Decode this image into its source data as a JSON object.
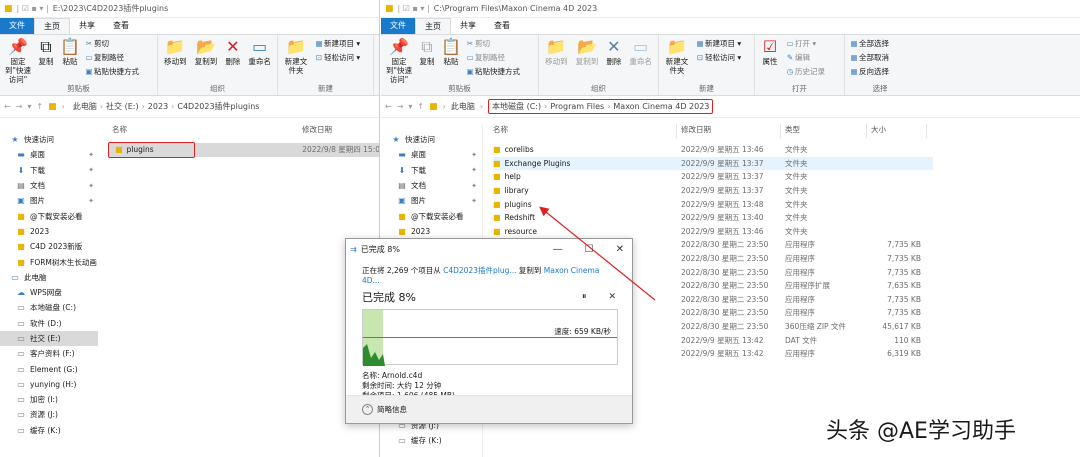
{
  "left": {
    "title_path": "E:\\2023\\C4D2023插件plugins",
    "tabs": [
      "文件",
      "主页",
      "共享",
      "查看"
    ],
    "ribbon": {
      "pin_label": "固定到\"快速访问\"",
      "copy_label": "复制",
      "paste_label": "粘贴",
      "cut_label": "剪切",
      "copy_path_label": "复制路径",
      "paste_shortcut_label": "粘贴快捷方式",
      "move_to_label": "移动到",
      "copy_to_label": "复制到",
      "delete_label": "删除",
      "rename_label": "重命名",
      "new_folder_label": "新建文件夹",
      "new_item_label": "新建项目",
      "easy_access_label": "轻松访问",
      "group_clipboard": "剪贴板",
      "group_organize": "组织",
      "group_new": "新建"
    },
    "crumbs": [
      "此电脑",
      "社交 (E:)",
      "2023",
      "C4D2023插件plugins"
    ],
    "columns": {
      "name": "名称",
      "modified": "修改日期"
    },
    "rows": [
      {
        "name": "plugins",
        "date": "2022/9/8 星期四 15:0"
      }
    ],
    "nav": [
      {
        "label": "快速访问",
        "icon": "star-icon",
        "header": true
      },
      {
        "label": "桌面",
        "icon": "desktop-icon",
        "pinned": true
      },
      {
        "label": "下载",
        "icon": "download-icon",
        "pinned": true
      },
      {
        "label": "文档",
        "icon": "document-icon",
        "pinned": true
      },
      {
        "label": "图片",
        "icon": "picture-icon",
        "pinned": true
      },
      {
        "label": "@下载安装必看",
        "icon": "folder-icon"
      },
      {
        "label": "2023",
        "icon": "folder-icon"
      },
      {
        "label": "C4D 2023新版",
        "icon": "folder-icon"
      },
      {
        "label": "FORM树木生长动画",
        "icon": "folder-icon"
      },
      {
        "label": "此电脑",
        "icon": "computer-icon",
        "header": true
      },
      {
        "label": "WPS网盘",
        "icon": "cloud-icon"
      },
      {
        "label": "本地磁盘 (C:)",
        "icon": "drive-icon"
      },
      {
        "label": "软件 (D:)",
        "icon": "drive-icon"
      },
      {
        "label": "社交 (E:)",
        "icon": "drive-icon",
        "selected": true
      },
      {
        "label": "客户资料 (F:)",
        "icon": "drive-icon"
      },
      {
        "label": "Element (G:)",
        "icon": "drive-icon"
      },
      {
        "label": "yunying (H:)",
        "icon": "drive-icon"
      },
      {
        "label": "加密 (I:)",
        "icon": "drive-icon"
      },
      {
        "label": "资源 (J:)",
        "icon": "drive-icon"
      },
      {
        "label": "缓存 (K:)",
        "icon": "drive-icon"
      }
    ]
  },
  "right": {
    "title_path": "C:\\Program Files\\Maxon Cinema 4D 2023",
    "tabs": [
      "文件",
      "主页",
      "共享",
      "查看"
    ],
    "ribbon": {
      "pin_label": "固定到\"快速访问\"",
      "copy_label": "复制",
      "paste_label": "粘贴",
      "cut_label": "剪切",
      "copy_path_label": "复制路径",
      "paste_shortcut_label": "粘贴快捷方式",
      "move_to_label": "移动到",
      "copy_to_label": "复制到",
      "delete_label": "删除",
      "rename_label": "重命名",
      "new_folder_label": "新建文件夹",
      "new_item_label": "新建项目",
      "easy_access_label": "轻松访问",
      "properties_label": "属性",
      "open_label": "打开",
      "edit_label": "编辑",
      "history_label": "历史记录",
      "select_all_label": "全部选择",
      "select_none_label": "全部取消",
      "invert_label": "反向选择",
      "group_clipboard": "剪贴板",
      "group_organize": "组织",
      "group_new": "新建",
      "group_open": "打开",
      "group_select": "选择"
    },
    "crumbs": [
      "此电脑",
      "本地磁盘 (C:)",
      "Program Files",
      "Maxon Cinema 4D 2023"
    ],
    "columns": {
      "name": "名称",
      "modified": "修改日期",
      "type": "类型",
      "size": "大小"
    },
    "rows": [
      {
        "name": "corelibs",
        "date": "2022/9/9 星期五 13:46",
        "type": "文件夹",
        "size": ""
      },
      {
        "name": "Exchange Plugins",
        "date": "2022/9/9 星期五 13:37",
        "type": "文件夹",
        "size": ""
      },
      {
        "name": "help",
        "date": "2022/9/9 星期五 13:37",
        "type": "文件夹",
        "size": ""
      },
      {
        "name": "library",
        "date": "2022/9/9 星期五 13:37",
        "type": "文件夹",
        "size": ""
      },
      {
        "name": "plugins",
        "date": "2022/9/9 星期五 13:48",
        "type": "文件夹",
        "size": ""
      },
      {
        "name": "Redshift",
        "date": "2022/9/9 星期五 13:40",
        "type": "文件夹",
        "size": ""
      },
      {
        "name": "resource",
        "date": "2022/9/9 星期五 13:46",
        "type": "文件夹",
        "size": ""
      },
      {
        "name": "",
        "date": "2022/8/30 星期二 23:50",
        "type": "应用程序",
        "size": "7,735 KB"
      },
      {
        "name": "",
        "date": "2022/8/30 星期二 23:50",
        "type": "应用程序",
        "size": "7,735 KB"
      },
      {
        "name": "",
        "date": "2022/8/30 星期二 23:50",
        "type": "应用程序",
        "size": "7,735 KB"
      },
      {
        "name": "",
        "date": "2022/8/30 星期二 23:50",
        "type": "应用程序扩展",
        "size": "7,635 KB"
      },
      {
        "name": "",
        "date": "2022/8/30 星期二 23:50",
        "type": "应用程序",
        "size": "7,735 KB"
      },
      {
        "name": "",
        "date": "2022/8/30 星期二 23:50",
        "type": "应用程序",
        "size": "7,735 KB"
      },
      {
        "name": "",
        "date": "2022/8/30 星期二 23:50",
        "type": "360压缩 ZIP 文件",
        "size": "45,617 KB"
      },
      {
        "name": "",
        "date": "2022/9/9 星期五 13:42",
        "type": "DAT 文件",
        "size": "110 KB"
      },
      {
        "name": "",
        "date": "2022/9/9 星期五 13:42",
        "type": "应用程序",
        "size": "6,319 KB"
      }
    ],
    "nav": [
      {
        "label": "快速访问",
        "icon": "star-icon",
        "header": true
      },
      {
        "label": "桌面",
        "icon": "desktop-icon",
        "pinned": true
      },
      {
        "label": "下载",
        "icon": "download-icon",
        "pinned": true
      },
      {
        "label": "文档",
        "icon": "document-icon",
        "pinned": true
      },
      {
        "label": "图片",
        "icon": "picture-icon",
        "pinned": true
      },
      {
        "label": "@下载安装必看",
        "icon": "folder-icon"
      },
      {
        "label": "2023",
        "icon": "folder-icon"
      }
    ],
    "nav_bottom": [
      {
        "label": "资源 (J:)",
        "icon": "drive-icon"
      },
      {
        "label": "缓存 (K:)",
        "icon": "drive-icon"
      }
    ]
  },
  "dialog": {
    "title": "已完成 8%",
    "line_prefix": "正在将 2,269 个项目从 ",
    "source": "C4D2023插件plug...",
    "line_mid": " 复制到 ",
    "dest": "Maxon Cinema 4D...",
    "percent_label": "已完成 8%",
    "progress_fraction": 0.08,
    "speed": "速度: 659 KB/秒",
    "name_line": "名称: Arnold.c4d",
    "time_line": "剩余时间: 大约 12 分钟",
    "items_line": "剩余项目: 1,606 (485 MB)",
    "details_label": "简略信息"
  },
  "watermark": "头条 @AE学习助手",
  "colors": {
    "accent": "#1979ca",
    "highlight": "#e02020",
    "graph_fill": "#c8e6b0"
  }
}
